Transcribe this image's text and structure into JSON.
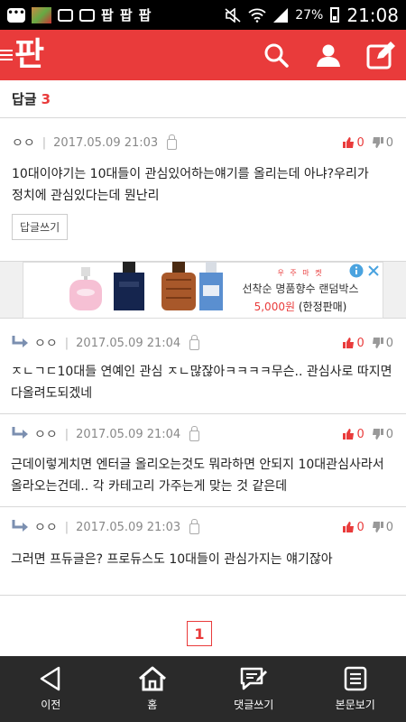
{
  "status_bar": {
    "pan_labels": [
      "팝",
      "팝",
      "팝"
    ],
    "battery": "27%",
    "time": "21:08"
  },
  "header": {
    "logo": "판",
    "icons": [
      "search-icon",
      "user-icon",
      "write-icon"
    ]
  },
  "replies": {
    "label": "답글",
    "count": "3"
  },
  "main_comment": {
    "author": "ㅇㅇ",
    "date": "2017.05.09 21:03",
    "likes": "0",
    "dislikes": "0",
    "body": "10대이야기는 10대들이 관심있어하는얘기를 올리는데 아냐?우리가 정치에 관심있다는데 뭔난리",
    "reply_button": "답글쓰기"
  },
  "ad": {
    "brand": "우 주 마 켓",
    "line1": "선착순 명품향수 랜덤박스",
    "price": "5,000원",
    "price_note": "(한정판매)",
    "icons": [
      "info-icon",
      "close-icon"
    ]
  },
  "sub_replies": [
    {
      "author": "ㅇㅇ",
      "date": "2017.05.09 21:04",
      "likes": "0",
      "dislikes": "0",
      "body": "ㅈㄴㄱㄷ10대들 연예인 관심 ㅈㄴ많잖아ㅋㅋㅋㅋ무슨.. 관심사로 따지면 다올려도되겠네"
    },
    {
      "author": "ㅇㅇ",
      "date": "2017.05.09 21:04",
      "likes": "0",
      "dislikes": "0",
      "body": "근데이렇게치면 엔터글 올리오는것도 뭐라하면 안되지 10대관심사라서 올라오는건데.. 각 카테고리 가주는게 맞는 것 같은데"
    },
    {
      "author": "ㅇㅇ",
      "date": "2017.05.09 21:03",
      "likes": "0",
      "dislikes": "0",
      "body": "그러면 프듀글은? 프로듀스도 10대들이 관심가지는 얘기잖아"
    }
  ],
  "pagination": {
    "current": "1"
  },
  "bottom_nav": [
    {
      "label": "이전",
      "icon": "back-icon"
    },
    {
      "label": "홈",
      "icon": "home-icon"
    },
    {
      "label": "댓글쓰기",
      "icon": "comment-write-icon"
    },
    {
      "label": "본문보기",
      "icon": "document-icon"
    }
  ],
  "colors": {
    "brand": "#e93b3b",
    "nav_bg": "#2a2a2a"
  }
}
